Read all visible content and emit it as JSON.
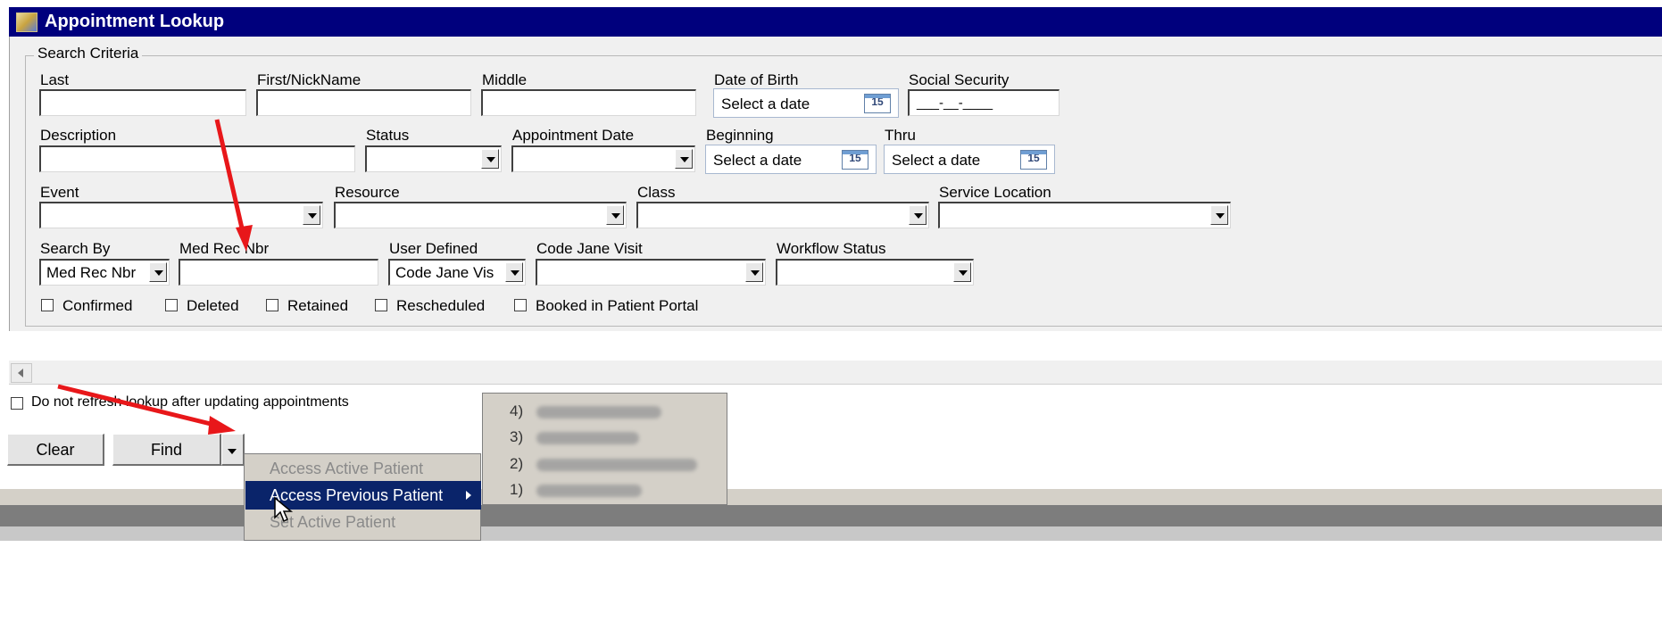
{
  "window": {
    "title": "Appointment Lookup"
  },
  "search_criteria": {
    "legend": "Search Criteria",
    "labels": {
      "last": "Last",
      "first": "First/NickName",
      "middle": "Middle",
      "dob": "Date of Birth",
      "ssn": "Social Security",
      "description": "Description",
      "status": "Status",
      "appt_date": "Appointment Date",
      "beginning": "Beginning",
      "thru": "Thru",
      "event": "Event",
      "resource": "Resource",
      "class": "Class",
      "service_location": "Service Location",
      "search_by": "Search By",
      "med_rec_nbr": "Med Rec Nbr",
      "user_defined": "User Defined",
      "code_jane_visit": "Code Jane Visit",
      "workflow_status": "Workflow Status"
    },
    "date_placeholder": "Select a date",
    "calendar_day": "15",
    "ssn_mask": "___-__-____",
    "search_by_value": "Med Rec Nbr",
    "user_defined_value": "Code Jane Visit",
    "checkboxes": [
      "Confirmed",
      "Deleted",
      "Retained",
      "Rescheduled",
      "Booked in Patient Portal"
    ]
  },
  "refresh_option": "Do not refresh lookup after updating appointments",
  "buttons": {
    "clear": "Clear",
    "find": "Find"
  },
  "context_menu": {
    "items": [
      "Access Active Patient",
      "Access Previous Patient",
      "Set Active Patient"
    ],
    "submenu_numbers": [
      "4)",
      "3)",
      "2)",
      "1)"
    ]
  },
  "colors": {
    "title_bar": "#00007d",
    "menu_highlight": "#0a246a",
    "annotation_arrow": "#e8171a"
  }
}
